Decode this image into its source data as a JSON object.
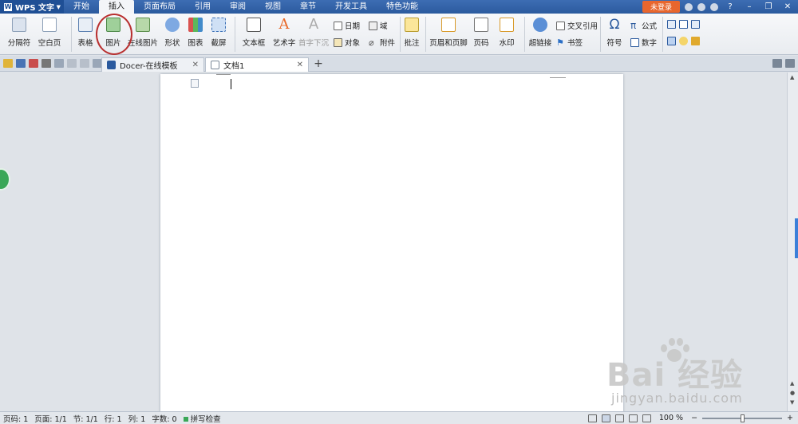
{
  "app": {
    "name": "WPS 文字"
  },
  "menu": {
    "tabs": [
      "开始",
      "插入",
      "页面布局",
      "引用",
      "审阅",
      "视图",
      "章节",
      "开发工具",
      "特色功能"
    ],
    "active_tab": "插入",
    "login": "未登录"
  },
  "ribbon": {
    "page_break": "分隔符",
    "blank_page": "空白页",
    "table": "表格",
    "picture": "图片",
    "online_picture": "在线图片",
    "shapes": "形状",
    "chart": "图表",
    "screenshot": "截屏",
    "textbox": "文本框",
    "wordart": "艺术字",
    "drop_cap": "首字下沉",
    "date": "日期",
    "field": "域",
    "object": "对象",
    "attachment": "附件",
    "comment": "批注",
    "header_footer": "页眉和页脚",
    "page_number": "页码",
    "watermark": "水印",
    "hyperlink": "超链接",
    "cross_ref": "交叉引用",
    "bookmark": "书签",
    "symbol": "符号",
    "formula": "公式",
    "number": "数字"
  },
  "colors": {
    "accent_blue": "#2b5a9e",
    "login_orange": "#e8662e",
    "highlight_circle": "#b83030"
  },
  "tabs": {
    "docer": "Docer-在线模板",
    "doc1": "文档1"
  },
  "status": {
    "page": "页码: 1",
    "pages": "页面: 1/1",
    "section": "节: 1/1",
    "line": "行: 1",
    "col": "列: 1",
    "words": "字数: 0",
    "spell": "拼写检查",
    "zoom": "100 %"
  },
  "watermark": {
    "main": "Bai 经验",
    "sub": "jingyan.baidu.com"
  }
}
